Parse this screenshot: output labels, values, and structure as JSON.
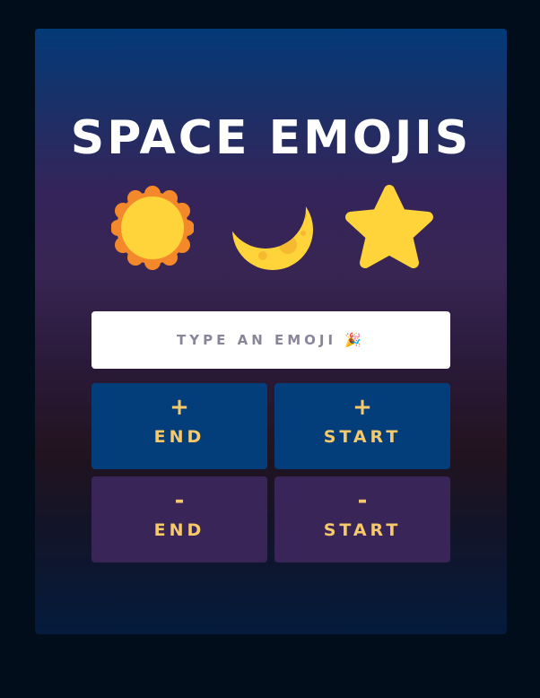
{
  "title": "SPACE EMOJIS",
  "icons": [
    "sun-icon",
    "crescent-moon-icon",
    "star-icon"
  ],
  "input": {
    "placeholder": "TYPE AN EMOJI 🎉",
    "value": ""
  },
  "buttons": {
    "add_end": {
      "symbol": "+",
      "label": "END"
    },
    "add_start": {
      "symbol": "+",
      "label": "START"
    },
    "remove_end": {
      "symbol": "-",
      "label": "END"
    },
    "remove_start": {
      "symbol": "-",
      "label": "START"
    }
  },
  "colors": {
    "page_background": "#010d1b",
    "add_button": "#033e7b",
    "remove_button": "#3a2558",
    "button_text": "#f6c96a",
    "sun_outer": "#f4892b",
    "emoji_yellow": "#ffd43b"
  }
}
